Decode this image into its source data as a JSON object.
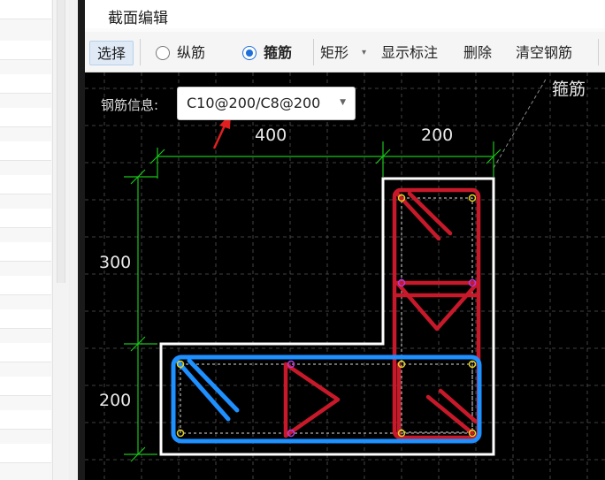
{
  "window": {
    "title": "截面编辑"
  },
  "toolbar": {
    "select_label": "选择",
    "longitudinal_label": "纵筋",
    "stirrup_label": "箍筋",
    "shape_label": "矩形",
    "show_annotation_label": "显示标注",
    "delete_label": "删除",
    "clear_rebar_label": "清空钢筋",
    "selected_mode": "stirrup"
  },
  "canvas": {
    "rebar_info_label": "钢筋信息:",
    "rebar_info_value": "C10@200/C8@200",
    "corner_label": "箍筋",
    "dimensions": {
      "top_left": "400",
      "top_right": "200",
      "left_top": "300",
      "left_bottom": "200"
    }
  },
  "colors": {
    "outline": "#ffffff",
    "red_stirrup": "#c8192a",
    "blue_stirrup": "#1e90ff",
    "dimension": "#19c419",
    "annotation_arrow": "#e02020",
    "grid": "#555555"
  }
}
